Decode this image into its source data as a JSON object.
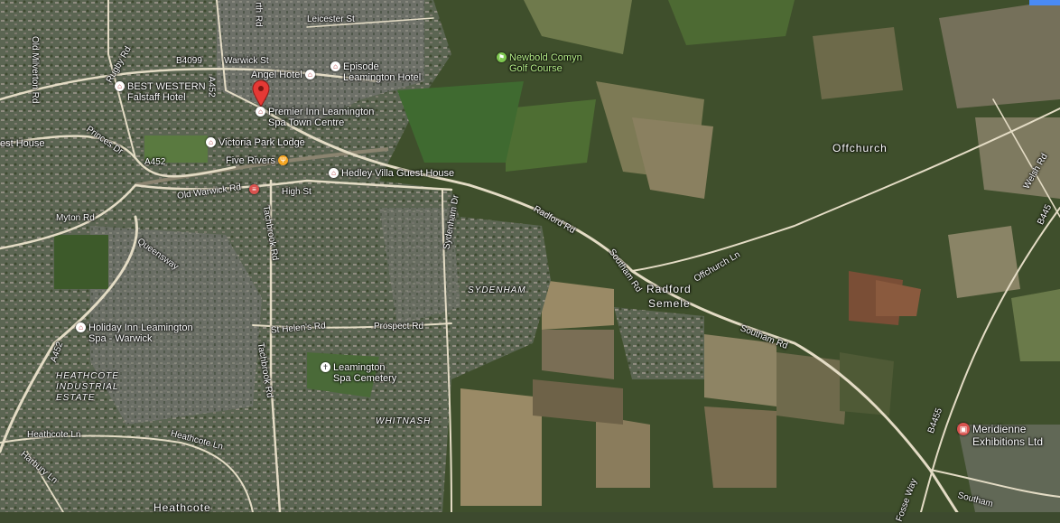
{
  "colors": {
    "pin": "#e53935",
    "fields_dark": "#2f3d1f",
    "fields_light": "#7a7a52",
    "urban": "#6b6f66",
    "road": "#d9d3c3"
  },
  "roads": {
    "leicester_st": "Leicester St",
    "rugby_rd": "Rugby Rd",
    "b4099": "B4099",
    "warwick_st": "Warwick St",
    "a452_north": "A452",
    "old_milverton_rd": "Old Milverton Rd",
    "princes_dr": "Princes Dr",
    "a452_mid": "A452",
    "old_warwick_rd": "Old Warwick Rd",
    "high_st": "High St",
    "myton_rd": "Myton Rd",
    "queensway": "Queensway",
    "tachbrook_rd_north": "Tachbrook Rd",
    "tachbrook_rd_south": "Tachbrook Rd",
    "sydenham_dr": "Sydenham Dr",
    "radford_rd": "Radford Rd",
    "southam_rd_mid": "Southam Rd",
    "offchurch_ln": "Offchurch Ln",
    "southam_rd_east": "Southam Rd",
    "welsh_rd": "Welsh Rd",
    "st_helens_rd": "St Helen's Rd",
    "prospect_rd": "Prospect Rd",
    "a452_south": "A452",
    "heathcote_ln_west": "Heathcote Ln",
    "heathcote_ln_east": "Heathcote Ln",
    "harbury_ln": "Harbury Ln",
    "b4455": "B4455",
    "fosse_way": "Fosse Way",
    "southam_rd_south": "Southam",
    "b445_edge": "B445",
    "north_clip": "rth Rd"
  },
  "places": {
    "offchurch": "Offchurch",
    "radford_semele_1": "Radford",
    "radford_semele_2": "Semele",
    "sydenham": "SYDENHAM",
    "heathcote_estate_1": "HEATHCOTE",
    "heathcote_estate_2": "INDUSTRIAL",
    "heathcote_estate_3": "ESTATE",
    "whitnash": "WHITNASH",
    "heathcote": "Heathcote"
  },
  "pois": {
    "angel_hotel": "Angel Hotel",
    "episode_1": "Episode",
    "episode_2": "Leamington Hotel",
    "best_western_1": "BEST WESTERN",
    "best_western_2": "Falstaff Hotel",
    "premier_inn_1": "Premier Inn Leamington",
    "premier_inn_2": "Spa Town Centre",
    "victoria_park": "Victoria Park Lodge",
    "five_rivers": "Five Rivers",
    "hedley_villa": "Hedley Villa Guest House",
    "guest_house_clip": "est House",
    "newbold_comyn_1": "Newbold Comyn",
    "newbold_comyn_2": "Golf Course",
    "holiday_inn_1": "Holiday Inn Leamington",
    "holiday_inn_2": "Spa - Warwick",
    "cemetery_1": "Leamington",
    "cemetery_2": "Spa Cemetery",
    "meridienne_1": "Meridienne",
    "meridienne_2": "Exhibitions Ltd"
  },
  "icons": {
    "hotel": "hotel-icon",
    "restaurant": "restaurant-icon",
    "golf": "golf-icon",
    "cemetery": "cemetery-icon",
    "museum": "venue-icon",
    "rail": "rail-icon",
    "pin": "map-pin-icon"
  }
}
